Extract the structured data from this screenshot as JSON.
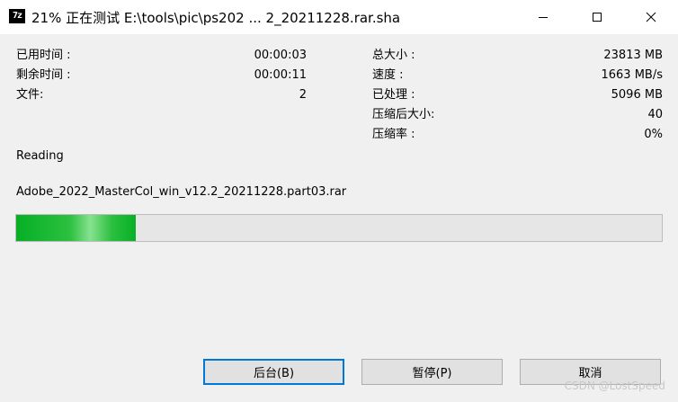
{
  "window": {
    "icon_text": "7z",
    "title": "21% 正在测试 E:\\tools\\pic\\ps202 ... 2_20211228.rar.sha"
  },
  "info_left": [
    {
      "label": "已用时间 :",
      "value": "00:00:03"
    },
    {
      "label": "剩余时间 :",
      "value": "00:00:11"
    },
    {
      "label": "文件:",
      "value": "2"
    }
  ],
  "info_right": [
    {
      "label": "总大小 :",
      "value": "23813 MB"
    },
    {
      "label": "速度 :",
      "value": "1663 MB/s"
    },
    {
      "label": "已处理 :",
      "value": "5096 MB"
    },
    {
      "label": "压缩后大小:",
      "value": "40"
    },
    {
      "label": "压缩率 :",
      "value": "0%"
    }
  ],
  "status": "Reading",
  "current_file": "Adobe_2022_MasterCol_win_v12.2_20211228.part03.rar",
  "progress": {
    "percent": 18.5,
    "color": "#06b025"
  },
  "buttons": {
    "background": "后台(B)",
    "pause": "暂停(P)",
    "cancel": "取消"
  },
  "watermark": "CSDN @LostSpeed"
}
